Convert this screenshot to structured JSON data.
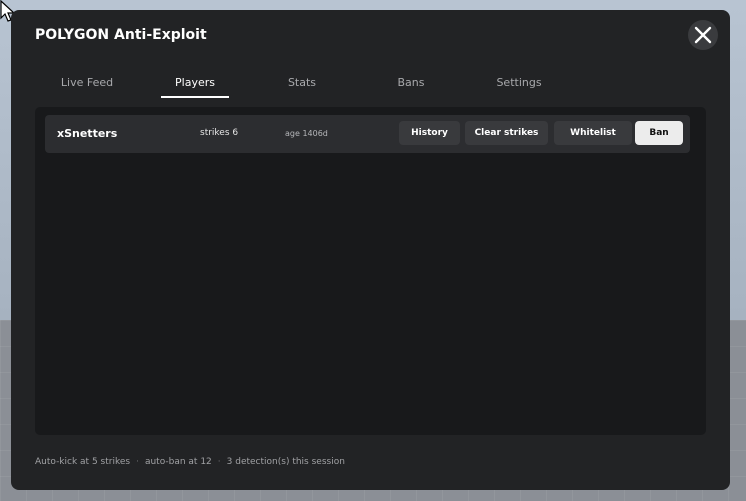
{
  "window": {
    "title": "POLYGON Anti-Exploit",
    "close_icon": "close-x-icon"
  },
  "tabs": [
    {
      "label": "Live Feed",
      "active": false
    },
    {
      "label": "Players",
      "active": true
    },
    {
      "label": "Stats",
      "active": false
    },
    {
      "label": "Bans",
      "active": false
    },
    {
      "label": "Settings",
      "active": false
    }
  ],
  "players": [
    {
      "name": "xSnetters",
      "strikes": "strikes 6",
      "age": "age 1406d",
      "actions": {
        "history": "History",
        "clear_strikes": "Clear strikes",
        "whitelist": "Whitelist",
        "ban": "Ban"
      }
    }
  ],
  "footer": {
    "auto_kick": "Auto-kick at 5 strikes",
    "auto_ban": "auto-ban at 12",
    "detections": "3 detection(s) this session",
    "separator": "·"
  },
  "colors": {
    "modal_bg": "#222325",
    "panel_bg": "#18191b",
    "row_bg": "#2c2d30",
    "button_bg": "#393a3d",
    "ban_button_bg": "#ececec"
  }
}
